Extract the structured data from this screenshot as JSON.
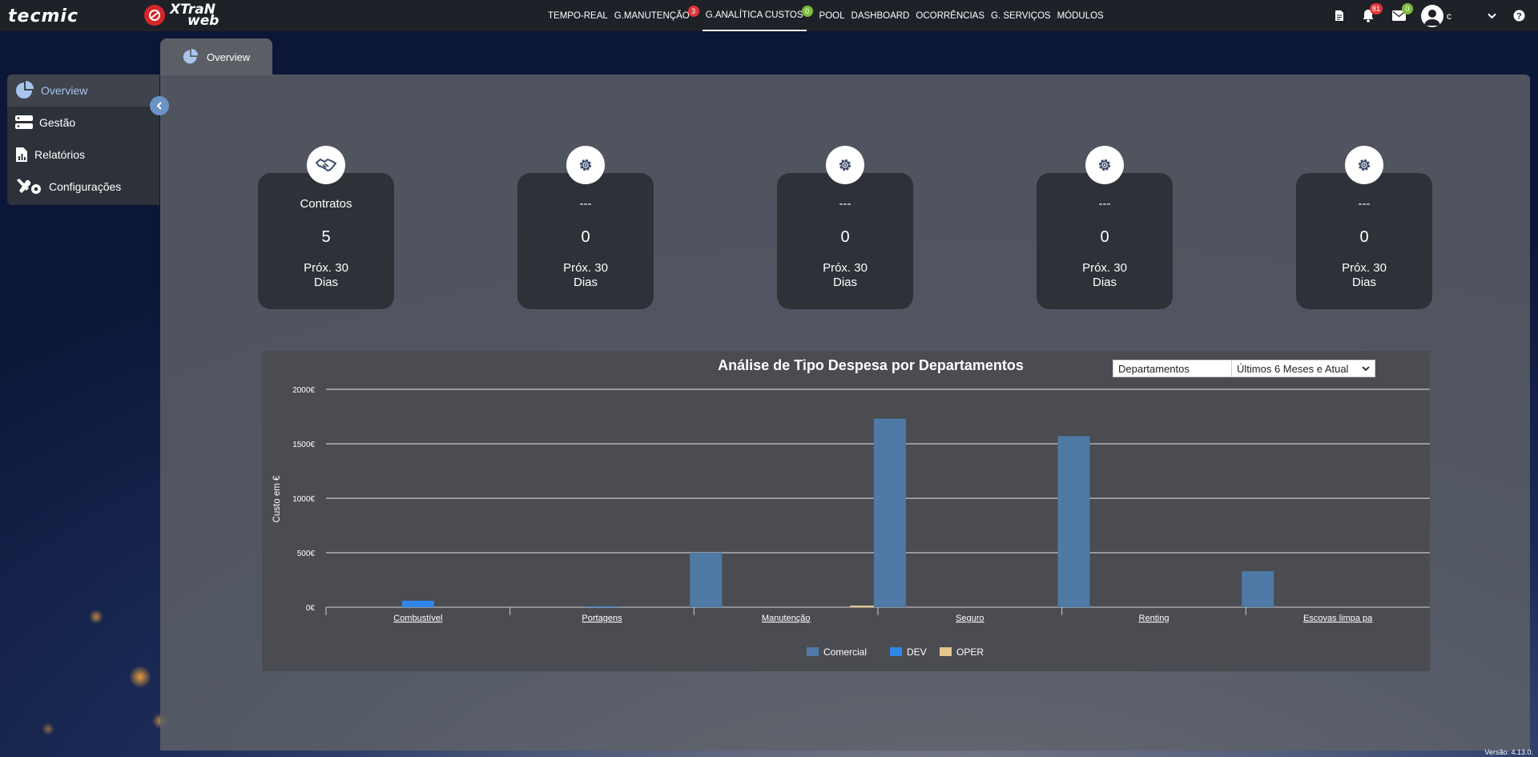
{
  "topbar": {
    "brand": "tecmic",
    "product_line1": "XTraN",
    "product_line2": "web",
    "nav": [
      {
        "label": "TEMPO-REAL",
        "badge": "",
        "badge_color": ""
      },
      {
        "label": "G.MANUTENÇÃO",
        "badge": "3",
        "badge_color": "red"
      },
      {
        "label": "G.ANALÍTICA CUSTOS",
        "badge": "0",
        "badge_color": "green",
        "active": true
      },
      {
        "label": "POOL",
        "badge": "",
        "badge_color": ""
      },
      {
        "label": "DASHBOARD",
        "badge": "",
        "badge_color": ""
      },
      {
        "label": "OCORRÊNCIAS",
        "badge": "",
        "badge_color": ""
      },
      {
        "label": "G. SERVIÇOS",
        "badge": "",
        "badge_color": ""
      },
      {
        "label": "MÓDULOS",
        "badge": "",
        "badge_color": ""
      }
    ],
    "notifications_count": "81",
    "messages_count": "0",
    "user_initial": "c"
  },
  "sidebar": {
    "items": [
      {
        "label": "Overview",
        "icon": "pie-chart-icon"
      },
      {
        "label": "Gestão",
        "icon": "server-icon"
      },
      {
        "label": "Relatórios",
        "icon": "report-icon"
      },
      {
        "label": "Configurações",
        "icon": "tools-icon"
      }
    ]
  },
  "tab": {
    "label": "Overview"
  },
  "cards": [
    {
      "title": "Contratos",
      "value": "5",
      "sub": "Próx. 30 Dias",
      "icon": "handshake-icon"
    },
    {
      "title": "---",
      "value": "0",
      "sub": "Próx. 30 Dias",
      "icon": "gear-icon"
    },
    {
      "title": "---",
      "value": "0",
      "sub": "Próx. 30 Dias",
      "icon": "gear-icon"
    },
    {
      "title": "---",
      "value": "0",
      "sub": "Próx. 30 Dias",
      "icon": "gear-icon"
    },
    {
      "title": "---",
      "value": "0",
      "sub": "Próx. 30 Dias",
      "icon": "gear-icon"
    }
  ],
  "filters": {
    "group_by": "Departamentos",
    "period": "Últimos 6 Meses e Atual"
  },
  "chart_data": {
    "type": "bar",
    "title": "Análise de Tipo Despesa por Departamentos",
    "ylabel": "Custo em €",
    "xlabel": "",
    "ylim": [
      0,
      2000
    ],
    "yticks": [
      "0€",
      "500€",
      "1000€",
      "1500€",
      "2000€"
    ],
    "categories": [
      "Combustível",
      "Portagens",
      "Manutenção",
      "Seguro",
      "Renting",
      "Escovas limpa pa"
    ],
    "series": [
      {
        "name": "Comercial",
        "color": "#4f7aa6",
        "values": [
          0,
          0,
          500,
          1730,
          1570,
          330
        ]
      },
      {
        "name": "DEV",
        "color": "#2f86e8",
        "values": [
          60,
          8,
          0,
          0,
          0,
          0
        ]
      },
      {
        "name": "OPER",
        "color": "#e5c48e",
        "values": [
          0,
          0,
          15,
          0,
          0,
          0
        ]
      }
    ],
    "legend_position": "bottom-center",
    "grid": true
  },
  "footer": {
    "version": "Versão: 4.13.0."
  }
}
